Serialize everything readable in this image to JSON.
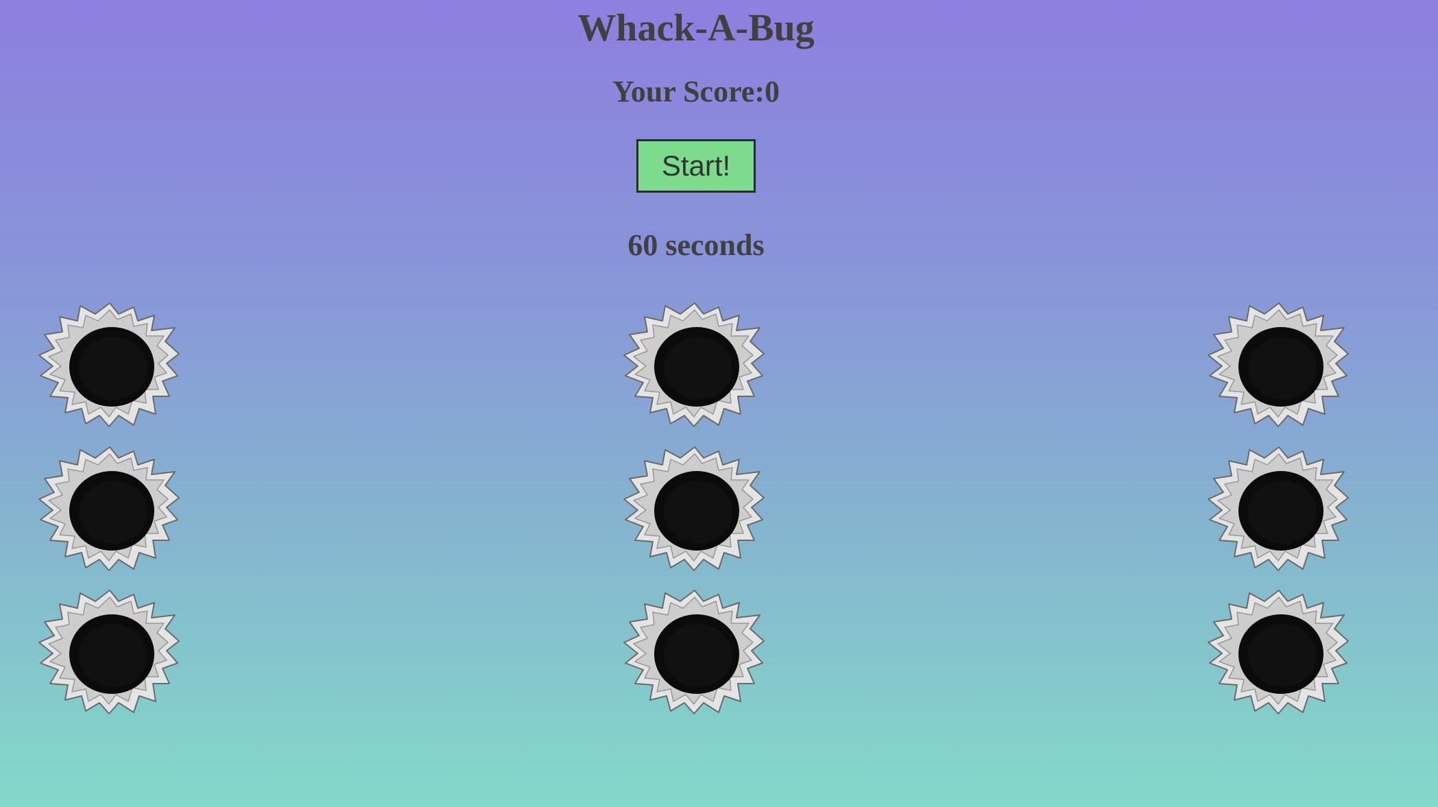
{
  "game": {
    "title": "Whack-A-Bug",
    "score_text": "Your Score:0",
    "start_label": "Start!",
    "timer_text": "60 seconds"
  },
  "board": {
    "rows": 3,
    "cols": 3,
    "holes": [
      "hole-1",
      "hole-2",
      "hole-3",
      "hole-4",
      "hole-5",
      "hole-6",
      "hole-7",
      "hole-8",
      "hole-9"
    ]
  },
  "colors": {
    "button": "#7ddb8d",
    "text": "#404040",
    "hole": "#0b0b0b"
  }
}
